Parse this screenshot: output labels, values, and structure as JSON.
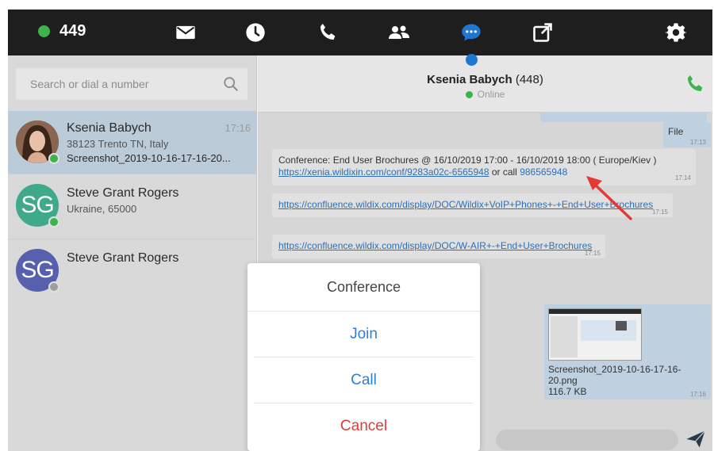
{
  "topbar": {
    "extension": "449",
    "icons": [
      "mail-icon",
      "clock-icon",
      "phone-icon",
      "users-icon",
      "chat-icon",
      "external-link-icon",
      "gear-icon"
    ]
  },
  "search": {
    "placeholder": "Search or dial a number"
  },
  "contacts": [
    {
      "name": "Ksenia Babych",
      "line1": "38123 Trento TN, Italy",
      "line2": "Screenshot_2019-10-16-17-16-20...",
      "time": "17:16",
      "status": "online"
    },
    {
      "name": "Steve Grant Rogers",
      "initials": "SG",
      "line1": "Ukraine, 65000",
      "status": "online"
    },
    {
      "name": "Steve Grant Rogers",
      "initials": "SG",
      "status": "offline"
    }
  ],
  "chat": {
    "contact_name": "Ksenia Babych",
    "contact_ext": "(448)",
    "status": "Online",
    "messages": {
      "file_label": "File",
      "file_time": "17:13",
      "conf_text": "Conference: End User Brochures @ 16/10/2019 17:00 - 16/10/2019 18:00 ( Europe/Kiev )",
      "conf_link": "https://xenia.wildixin.com/conf/9283a02c-6565948",
      "conf_or": " or call ",
      "conf_number": "986565948",
      "conf_time": "17:14",
      "link1": "https://confluence.wildix.com/display/DOC/Wildix+VoIP+Phones+-+End+User+Brochures",
      "link1_time": "17:15",
      "link2": "https://confluence.wildix.com/display/DOC/W-AIR+-+End+User+Brochures",
      "link2_time": "17:15",
      "screenshot_name": "Screenshot_2019-10-16-17-16-20.png",
      "screenshot_size": "116.7 KB",
      "screenshot_time": "17:16"
    }
  },
  "dialog": {
    "title": "Conference",
    "join": "Join",
    "call": "Call",
    "cancel": "Cancel"
  },
  "colors": {
    "accent": "#1e78d2",
    "online": "#3cb44b",
    "cancel": "#e53935",
    "action": "#2f80d2",
    "topbar": "#1e1e1e"
  }
}
